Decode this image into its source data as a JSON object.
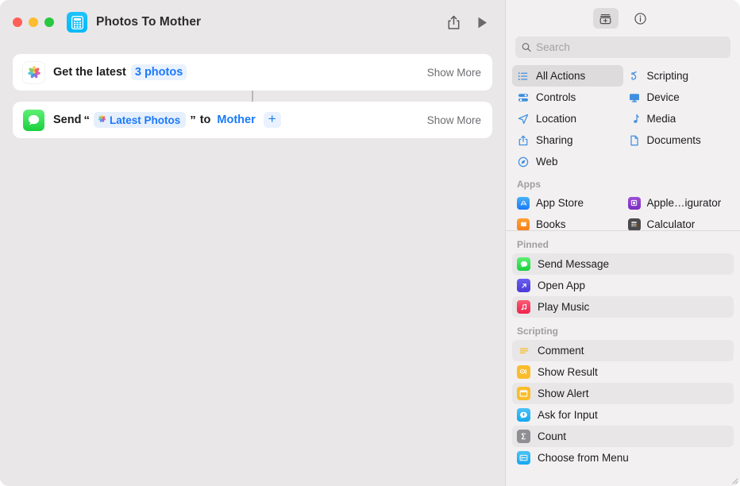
{
  "window": {
    "title": "Photos To Mother",
    "app_icon": "shortcut-calculator-icon",
    "traffic_lights": [
      "close",
      "minimize",
      "zoom"
    ],
    "share_icon": "share-icon",
    "run_icon": "play-icon",
    "colors": {
      "editor_bg": "#EAE7E8",
      "library_bg": "#F2F0F1",
      "card_bg": "#FFFFFF",
      "accent_blue": "#1A7AFB",
      "token_bg": "#E6EFFD",
      "selected_row": "#DDDBDC",
      "alt_row": "#E8E6E7"
    }
  },
  "editor": {
    "actions": [
      {
        "icon": "photos-app-icon",
        "prefix": "Get the latest",
        "parameter": "3 photos",
        "show_more": "Show More"
      },
      {
        "icon": "messages-app-icon",
        "prefix": "Send",
        "open_quote": "“",
        "token": {
          "icon": "photos-variable-icon",
          "label": "Latest Photos"
        },
        "close_quote": "”",
        "middle": "to",
        "recipient": "Mother",
        "add_label": "+",
        "show_more": "Show More"
      }
    ]
  },
  "library": {
    "tabs": [
      {
        "name": "action-library-tab",
        "icon": "action-library-icon",
        "selected": true
      },
      {
        "name": "shortcut-details-tab",
        "icon": "info-circle-icon",
        "selected": false
      }
    ],
    "search": {
      "placeholder": "Search",
      "value": "",
      "icon": "search-icon"
    },
    "categories": [
      {
        "label": "All Actions",
        "icon": "list-bullet-icon",
        "selected": true
      },
      {
        "label": "Scripting",
        "icon": "scripting-icon",
        "selected": false
      },
      {
        "label": "Controls",
        "icon": "controls-icon",
        "selected": false
      },
      {
        "label": "Device",
        "icon": "device-display-icon",
        "selected": false
      },
      {
        "label": "Location",
        "icon": "location-arrow-icon",
        "selected": false
      },
      {
        "label": "Media",
        "icon": "music-note-icon",
        "selected": false
      },
      {
        "label": "Sharing",
        "icon": "share-up-icon",
        "selected": false
      },
      {
        "label": "Documents",
        "icon": "document-page-icon",
        "selected": false
      },
      {
        "label": "Web",
        "icon": "safari-compass-icon",
        "selected": false
      }
    ],
    "apps_header": "Apps",
    "apps": [
      {
        "label": "App Store",
        "icon": "app-store-icon"
      },
      {
        "label": "Apple…igurator",
        "icon": "apple-configurator-icon"
      },
      {
        "label": "Books",
        "icon": "books-icon"
      },
      {
        "label": "Calculator",
        "icon": "calculator-icon"
      }
    ],
    "sections": [
      {
        "header": "Pinned",
        "rows": [
          {
            "label": "Send Message",
            "icon": "messages-app-icon",
            "highlighted": true
          },
          {
            "label": "Open App",
            "icon": "open-app-icon",
            "highlighted": false
          },
          {
            "label": "Play Music",
            "icon": "music-app-icon",
            "highlighted": true
          }
        ]
      },
      {
        "header": "Scripting",
        "rows": [
          {
            "label": "Comment",
            "icon": "comment-icon",
            "highlighted": true
          },
          {
            "label": "Show Result",
            "icon": "show-result-icon",
            "highlighted": false
          },
          {
            "label": "Show Alert",
            "icon": "show-alert-icon",
            "highlighted": true
          },
          {
            "label": "Ask for Input",
            "icon": "ask-for-input-icon",
            "highlighted": false
          },
          {
            "label": "Count",
            "icon": "count-sigma-icon",
            "highlighted": true
          },
          {
            "label": "Choose from Menu",
            "icon": "choose-from-menu-icon",
            "highlighted": false
          }
        ]
      }
    ]
  }
}
